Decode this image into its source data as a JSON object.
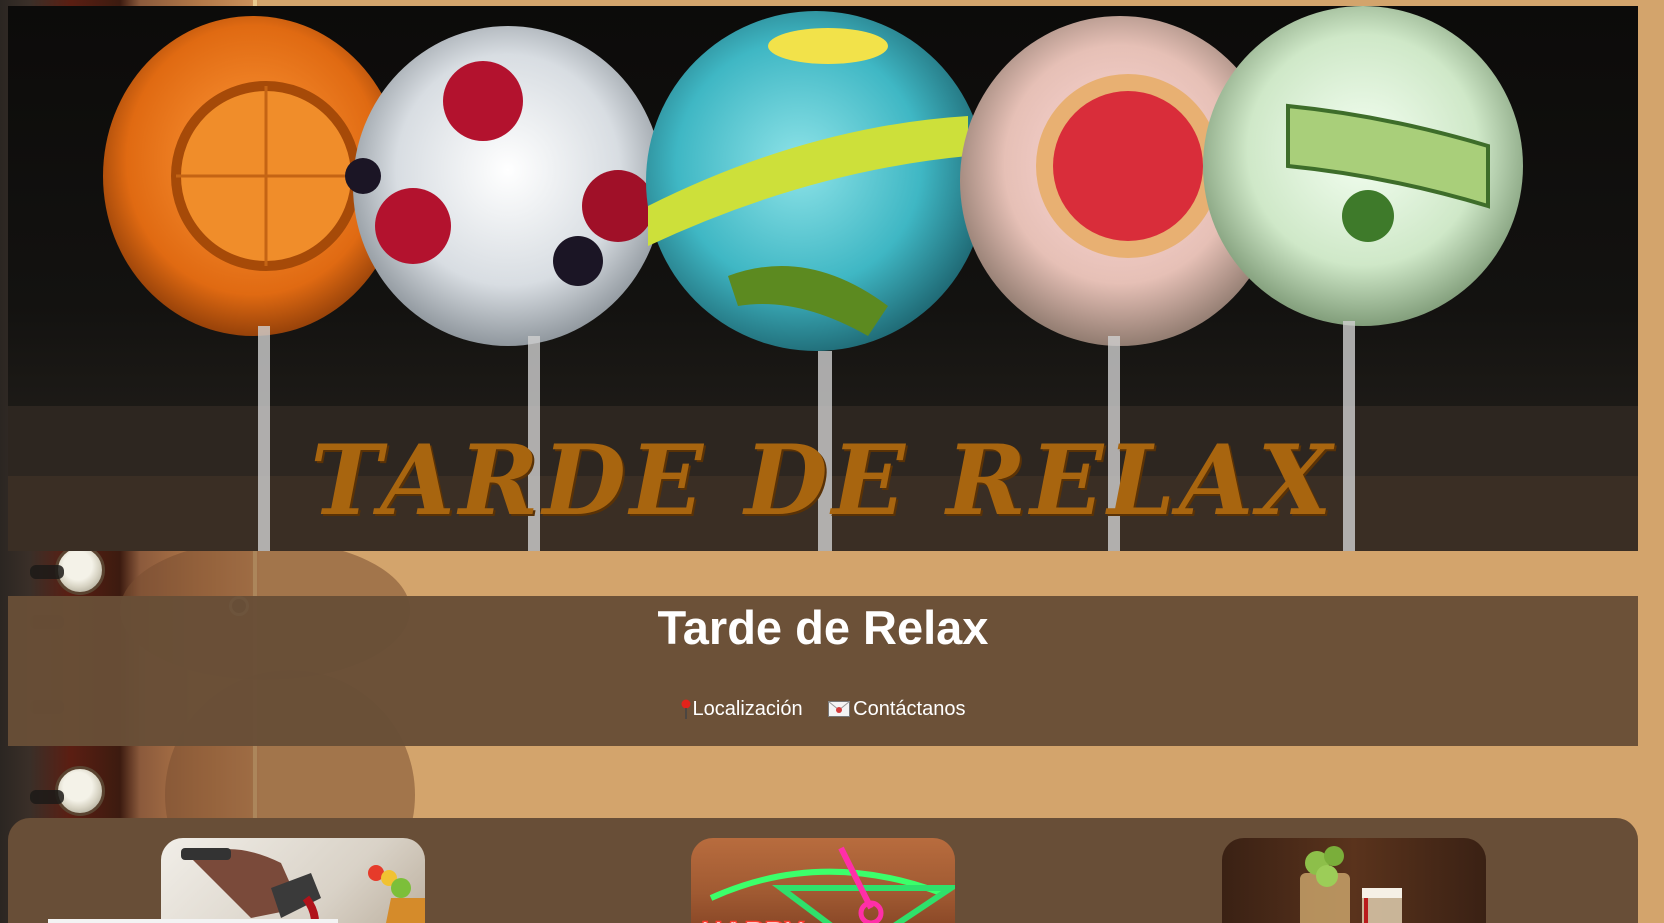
{
  "hero": {
    "banner_text": "TARDE DE RELAX"
  },
  "header": {
    "site_title": "Tarde de Relax"
  },
  "nav": {
    "items": [
      {
        "label": "Localización",
        "icon": "map-pin-icon"
      },
      {
        "label": "Contáctanos",
        "icon": "envelope-icon"
      }
    ]
  },
  "cards": [
    {
      "icon": "bartender-cocktail-image"
    },
    {
      "icon": "happy-hour-neon-image"
    },
    {
      "icon": "beer-hops-image"
    }
  ],
  "colors": {
    "page_background": "#d3a46c",
    "header_band": "#684e37",
    "banner_text": "#a8650f",
    "title_text": "#ffffff"
  }
}
